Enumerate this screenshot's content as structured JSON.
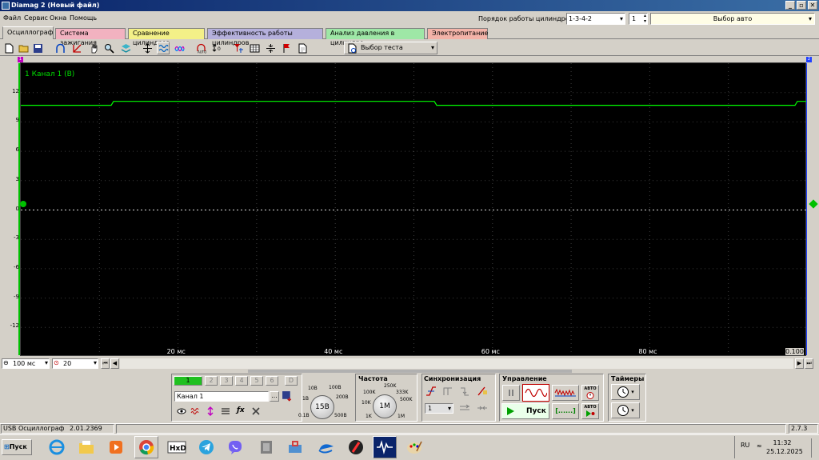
{
  "window": {
    "title": "Diamag 2 (Новый файл)"
  },
  "menu": [
    "Файл",
    "Сервис",
    "Окна",
    "Помощь"
  ],
  "header": {
    "cyl_order_label": "Порядок работы цилиндров",
    "cyl_order_value": "1-3-4-2",
    "cyl_number": "1",
    "car_select": "Выбор авто"
  },
  "tabs": [
    "Осциллограф",
    "Система зажигания",
    "Сравнение цилиндров",
    "Эффективность работы цилиндров",
    "Анализ давления в цилиндре",
    "Электропитание"
  ],
  "toolbar": {
    "test_select": "Выбор теста"
  },
  "plot": {
    "channel_label": "1 Канал 1 (В)",
    "marker_left": "1",
    "marker_right": "2",
    "y_ticks": [
      "12",
      "9",
      "6",
      "3",
      "0",
      "-3",
      "-6",
      "-9",
      "-12"
    ],
    "x_ticks": [
      "20 мс",
      "40 мс",
      "60 мс",
      "80 мс",
      "0.100"
    ],
    "colors": {
      "trace": "#00ff00",
      "background": "#000000",
      "grid": "#3c3c3c"
    }
  },
  "timebase": {
    "time_value": "100 мс",
    "rate_value": "20"
  },
  "channels": {
    "buttons": [
      "1",
      "2",
      "3",
      "4",
      "5",
      "6",
      "D"
    ],
    "name": "Канал 1",
    "ellipsis": "...",
    "volt_labels": [
      "10В",
      "100В",
      "1В",
      "200В",
      "0.1В",
      "500В"
    ],
    "volt_value": "15В"
  },
  "frequency": {
    "title": "Частота",
    "labels": [
      "250K",
      "100K",
      "333K",
      "10K",
      "500K",
      "1K",
      "1M"
    ],
    "value": "1M"
  },
  "sync": {
    "title": "Синхронизация",
    "value": "1"
  },
  "control": {
    "title": "Управление",
    "start": "Пуск",
    "auto1": "АВТО",
    "auto2": "АВТО",
    "bracket": "[......]"
  },
  "timers": {
    "title": "Таймеры"
  },
  "status": {
    "device": "USB Осциллограф",
    "version": "2.01.2369",
    "right": "2.7.3"
  },
  "taskbar": {
    "start": "Пуск",
    "lang": "RU",
    "up": "≈",
    "time": "11:32",
    "date": "25.12.2025"
  }
}
